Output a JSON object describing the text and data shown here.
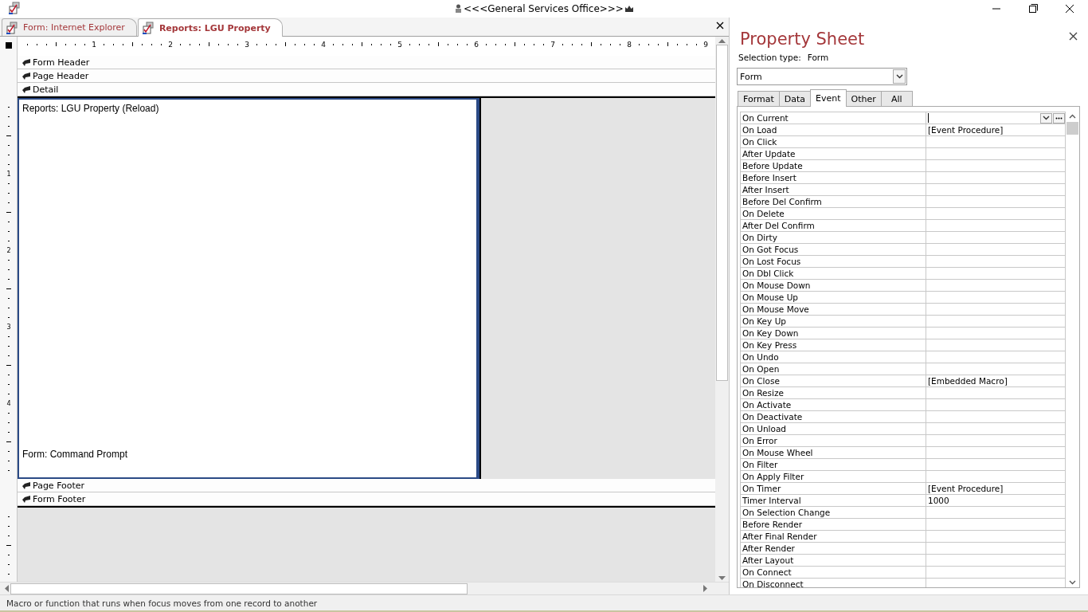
{
  "window": {
    "title": "<<<General Services Office>>>"
  },
  "document_tabs": [
    {
      "label": "Form: Internet Explorer",
      "selected": false
    },
    {
      "label": "Reports: LGU Property",
      "selected": true
    }
  ],
  "ruler": {
    "horizontal_marks": [
      "1",
      "2",
      "3",
      "4",
      "5",
      "6",
      "7",
      "8",
      "9"
    ],
    "vertical_marks": [
      "1",
      "2",
      "3",
      "4"
    ]
  },
  "sections_top": [
    "Form Header",
    "Page Header",
    "Detail"
  ],
  "detail_labels": [
    "Reports: LGU Property (Reload)",
    "Form: Command Prompt"
  ],
  "sections_bottom": [
    "Page Footer",
    "Form Footer"
  ],
  "property_sheet": {
    "title": "Property Sheet",
    "selection_type_label": "Selection type:",
    "selection_type": "Form",
    "object_combo": "Form",
    "tabs": [
      {
        "label": "Format",
        "selected": false
      },
      {
        "label": "Data",
        "selected": false
      },
      {
        "label": "Event",
        "selected": true
      },
      {
        "label": "Other",
        "selected": false
      },
      {
        "label": "All",
        "selected": false
      }
    ],
    "rows": [
      {
        "name": "On Current",
        "value": "",
        "selected": true
      },
      {
        "name": "On Load",
        "value": "[Event Procedure]",
        "selected": false
      },
      {
        "name": "On Click",
        "value": "",
        "selected": false
      },
      {
        "name": "After Update",
        "value": "",
        "selected": false
      },
      {
        "name": "Before Update",
        "value": "",
        "selected": false
      },
      {
        "name": "Before Insert",
        "value": "",
        "selected": false
      },
      {
        "name": "After Insert",
        "value": "",
        "selected": false
      },
      {
        "name": "Before Del Confirm",
        "value": "",
        "selected": false
      },
      {
        "name": "On Delete",
        "value": "",
        "selected": false
      },
      {
        "name": "After Del Confirm",
        "value": "",
        "selected": false
      },
      {
        "name": "On Dirty",
        "value": "",
        "selected": false
      },
      {
        "name": "On Got Focus",
        "value": "",
        "selected": false
      },
      {
        "name": "On Lost Focus",
        "value": "",
        "selected": false
      },
      {
        "name": "On Dbl Click",
        "value": "",
        "selected": false
      },
      {
        "name": "On Mouse Down",
        "value": "",
        "selected": false
      },
      {
        "name": "On Mouse Up",
        "value": "",
        "selected": false
      },
      {
        "name": "On Mouse Move",
        "value": "",
        "selected": false
      },
      {
        "name": "On Key Up",
        "value": "",
        "selected": false
      },
      {
        "name": "On Key Down",
        "value": "",
        "selected": false
      },
      {
        "name": "On Key Press",
        "value": "",
        "selected": false
      },
      {
        "name": "On Undo",
        "value": "",
        "selected": false
      },
      {
        "name": "On Open",
        "value": "",
        "selected": false
      },
      {
        "name": "On Close",
        "value": "[Embedded Macro]",
        "selected": false
      },
      {
        "name": "On Resize",
        "value": "",
        "selected": false
      },
      {
        "name": "On Activate",
        "value": "",
        "selected": false
      },
      {
        "name": "On Deactivate",
        "value": "",
        "selected": false
      },
      {
        "name": "On Unload",
        "value": "",
        "selected": false
      },
      {
        "name": "On Error",
        "value": "",
        "selected": false
      },
      {
        "name": "On Mouse Wheel",
        "value": "",
        "selected": false
      },
      {
        "name": "On Filter",
        "value": "",
        "selected": false
      },
      {
        "name": "On Apply Filter",
        "value": "",
        "selected": false
      },
      {
        "name": "On Timer",
        "value": "[Event Procedure]",
        "selected": false
      },
      {
        "name": "Timer Interval",
        "value": "1000",
        "selected": false
      },
      {
        "name": "On Selection Change",
        "value": "",
        "selected": false
      },
      {
        "name": "Before Render",
        "value": "",
        "selected": false
      },
      {
        "name": "After Final Render",
        "value": "",
        "selected": false
      },
      {
        "name": "After Render",
        "value": "",
        "selected": false
      },
      {
        "name": "After Layout",
        "value": "",
        "selected": false
      },
      {
        "name": "On Connect",
        "value": "",
        "selected": false
      },
      {
        "name": "On Disconnect",
        "value": "",
        "selected": false
      }
    ]
  },
  "status_bar": {
    "text": "Macro or function that runs when focus moves from one record to another"
  }
}
